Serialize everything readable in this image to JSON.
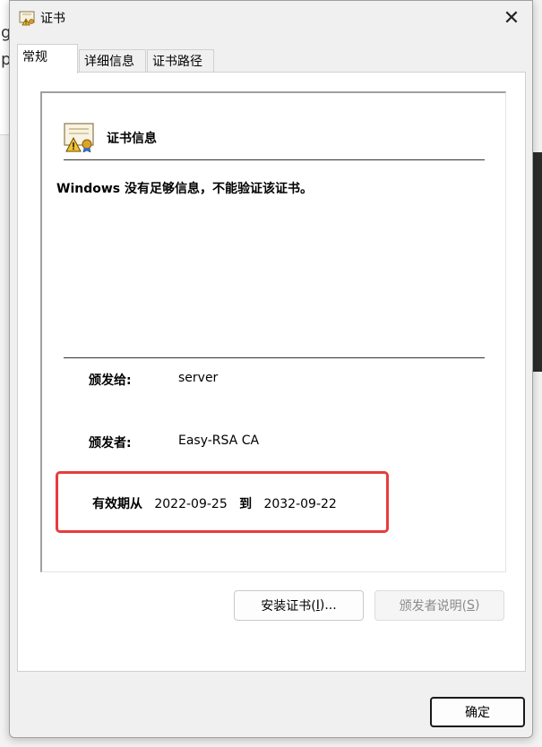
{
  "window": {
    "title": "证书",
    "close_glyph": "✕"
  },
  "background": {
    "glyphs": [
      "g",
      "p"
    ]
  },
  "tabs": [
    {
      "label": "常规",
      "active": true
    },
    {
      "label": "详细信息",
      "active": false
    },
    {
      "label": "证书路径",
      "active": false
    }
  ],
  "general": {
    "section_title": "证书信息",
    "warning": "Windows 没有足够信息，不能验证该证书。",
    "issued_to_label": "颁发给:",
    "issued_to_value": "server",
    "issued_by_label": "颁发者:",
    "issued_by_value": "Easy-RSA CA",
    "validity_label": "有效期从",
    "valid_from": "2022-09-25",
    "validity_to_word": "到",
    "valid_to": "2032-09-22"
  },
  "buttons": {
    "install_label": "安装证书(",
    "install_key": "I",
    "install_suffix": ")...",
    "issuer_statement_label": "颁发者说明(",
    "issuer_statement_key": "S",
    "issuer_statement_suffix": ")",
    "ok_label": "确定"
  },
  "colors": {
    "highlight": "#e83c3c",
    "dialog_bg": "#f0f0f0"
  },
  "icons": {
    "title_icon": "certificate-warning-icon",
    "info_icon": "certificate-warning-icon"
  }
}
